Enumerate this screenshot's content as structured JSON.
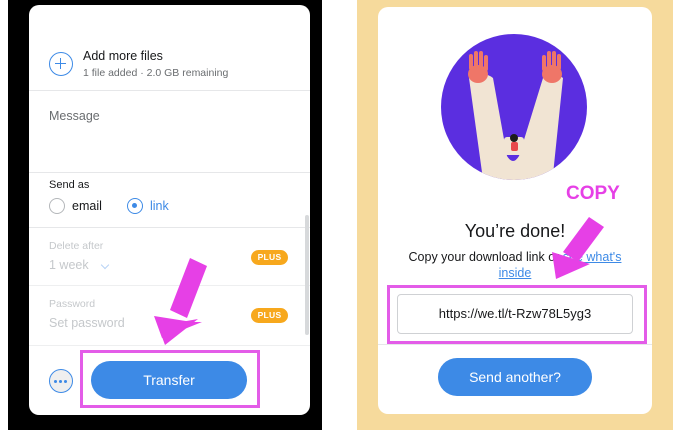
{
  "left": {
    "add_files": {
      "title": "Add more files",
      "subtitle": "1 file added · 2.0 GB remaining",
      "icon": "plus-circle-icon"
    },
    "message": {
      "placeholder": "Message"
    },
    "send_as": {
      "label": "Send as",
      "options": [
        {
          "label": "email",
          "selected": false
        },
        {
          "label": "link",
          "selected": true
        }
      ]
    },
    "delete_after": {
      "label": "Delete after",
      "value": "1 week",
      "badge": "PLUS"
    },
    "password": {
      "label": "Password",
      "placeholder": "Set password",
      "badge": "PLUS"
    },
    "more_icon": "ellipsis-circle-icon",
    "transfer_label": "Transfer"
  },
  "right": {
    "title": "You’re done!",
    "copy_prefix": "Copy your download link or ",
    "see_link": "see what's",
    "see_link_2": "inside",
    "url": "https://we.tl/t-Rzw78L5yg3",
    "send_another_label": "Send another?"
  },
  "annotations": {
    "copy_note": "COPY",
    "highlight_color": "#e35ce8"
  },
  "colors": {
    "accent": "#3d8ae6",
    "badge": "#f7a81d",
    "right_background": "#f6da9c",
    "illustration": "#5b2ee0"
  }
}
